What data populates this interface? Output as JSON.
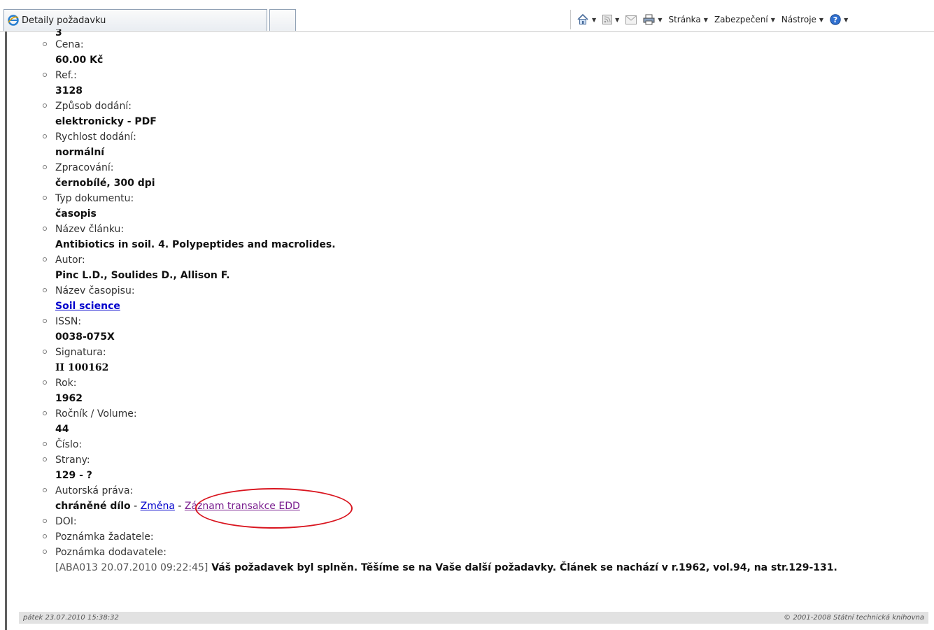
{
  "browser": {
    "tab_title": "Detaily požadavku",
    "commands": {
      "page": "Stránka",
      "security": "Zabezpečení",
      "tools": "Nástroje"
    }
  },
  "record": {
    "top_value": "3",
    "fields": [
      {
        "label": "Cena:",
        "value": "60.00 Kč"
      },
      {
        "label": "Ref.:",
        "value": "3128"
      },
      {
        "label": "Způsob dodání:",
        "value": "elektronicky - PDF"
      },
      {
        "label": "Rychlost dodání:",
        "value": "normální"
      },
      {
        "label": "Zpracování:",
        "value": "černobílé, 300 dpi"
      },
      {
        "label": "Typ dokumentu:",
        "value": "časopis"
      },
      {
        "label": "Název článku:",
        "value": "Antibiotics in soil. 4. Polypeptides and macrolides."
      },
      {
        "label": "Autor:",
        "value": "Pinc L.D., Soulides D., Allison F."
      },
      {
        "label": "Název časopisu:",
        "value": "Soil science"
      },
      {
        "label": "ISSN:",
        "value": "0038-075X"
      },
      {
        "label": "Signatura:",
        "value": "II 100162"
      },
      {
        "label": "Rok:",
        "value": "1962"
      },
      {
        "label": "Ročník / Volume:",
        "value": "44"
      },
      {
        "label": "Číslo:"
      },
      {
        "label": "Strany:",
        "value": "129 - ?"
      },
      {
        "label": "Autorská práva:",
        "value": "chráněné dílo",
        "sep1": " - ",
        "link_change": "Změna",
        "sep2": " - ",
        "link_edd": "Záznam transakce EDD"
      },
      {
        "label": "DOI:"
      },
      {
        "label": "Poznámka žadatele:"
      },
      {
        "label": "Poznámka dodavatele:",
        "stamp": "[ABA013 20.07.2010 09:22:45]",
        "value": "Váš požadavek byl splněn. Těšíme se na Vaše další požadavky. Článek se nachází v r.1962, vol.94, na str.129-131."
      }
    ]
  },
  "footer": {
    "date": "pátek 23.07.2010 15:38:32",
    "copyright": "© 2001-2008 Státní technická knihovna"
  },
  "colors": {
    "link": "#0000cc",
    "visited_link": "#7a1f8f",
    "annotation": "#d9151f"
  }
}
